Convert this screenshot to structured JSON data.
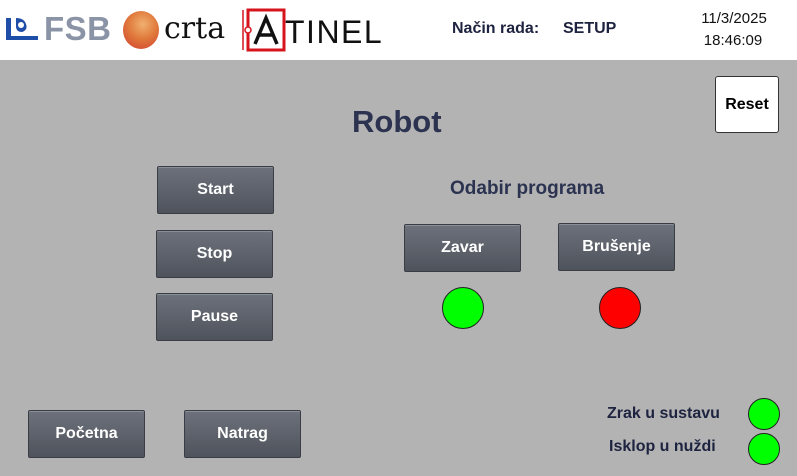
{
  "header": {
    "logos": {
      "fsb": "FSB",
      "crta": "crta",
      "atinel": "TINEL"
    },
    "mode_label": "Način rada:",
    "mode_value": "SETUP",
    "date": "11/3/2025",
    "time": "18:46:09"
  },
  "main": {
    "title": "Robot",
    "reset_label": "Reset",
    "control_buttons": {
      "start": "Start",
      "stop": "Stop",
      "pause": "Pause"
    },
    "program_section": {
      "heading": "Odabir programa",
      "zavar_label": "Zavar",
      "brusenje_label": "Brušenje",
      "zavar_indicator_color": "#00ff00",
      "brusenje_indicator_color": "#ff0000"
    }
  },
  "footer": {
    "nav": {
      "home_label": "Početna",
      "back_label": "Natrag"
    },
    "status": {
      "air_label": "Zrak u sustavu",
      "air_color": "#00ff00",
      "estop_label": "Isklop u nuždi",
      "estop_color": "#00ff00"
    }
  }
}
